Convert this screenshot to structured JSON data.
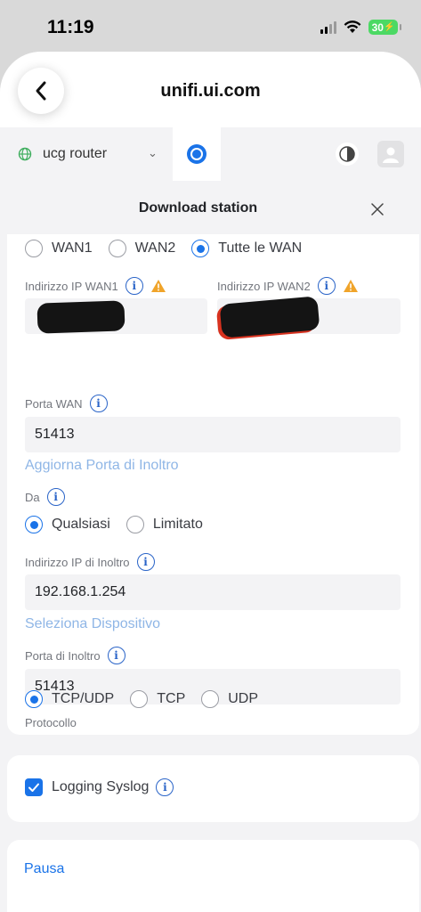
{
  "status_bar": {
    "time": "11:19",
    "battery": "30"
  },
  "browser": {
    "url": "unifi.ui.com"
  },
  "topbar": {
    "site_name": "ucg router"
  },
  "modal": {
    "title": "Download station"
  },
  "wan_options": [
    "WAN1",
    "WAN2",
    "Tutte le WAN"
  ],
  "wan_selected": "Tutte le WAN",
  "wan1_ip": {
    "label": "Indirizzo IP WAN1"
  },
  "wan2_ip": {
    "label": "Indirizzo IP WAN2"
  },
  "wan_port": {
    "label": "Porta WAN",
    "value": "51413"
  },
  "update_forward_port_link": "Aggiorna Porta di Inoltro",
  "from": {
    "label": "Da",
    "options": [
      "Qualsiasi",
      "Limitato"
    ],
    "selected": "Qualsiasi"
  },
  "forward_ip": {
    "label": "Indirizzo IP di Inoltro",
    "value": "192.168.1.254"
  },
  "select_device_link": "Seleziona Dispositivo",
  "forward_port": {
    "label": "Porta di Inoltro",
    "value": "51413"
  },
  "protocol": {
    "label": "Protocollo",
    "options": [
      "TCP/UDP",
      "TCP",
      "UDP"
    ],
    "selected": "TCP/UDP"
  },
  "syslog": {
    "label": "Logging Syslog",
    "checked": true
  },
  "pause_link": "Pausa",
  "colors": {
    "accent": "#1a73e8",
    "link_light": "#8fb6e6",
    "warning": "#f0a42a",
    "field_bg": "#f3f3f5"
  }
}
